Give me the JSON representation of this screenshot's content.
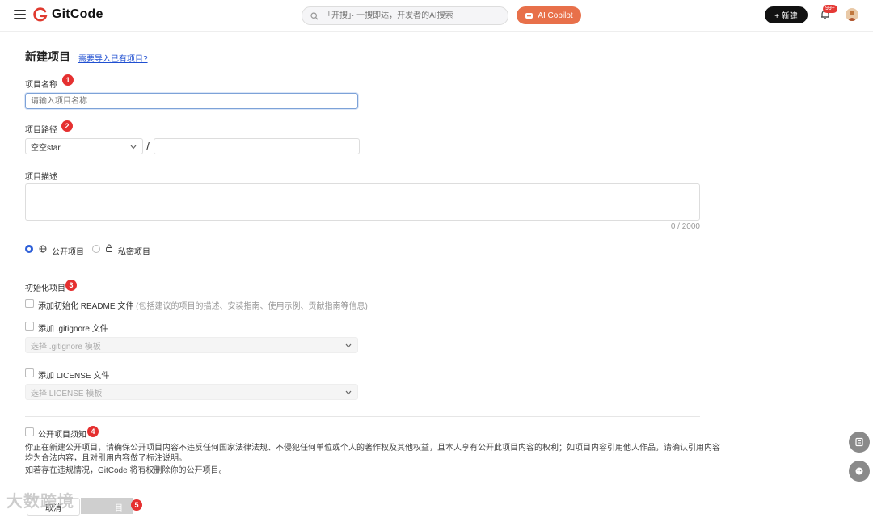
{
  "header": {
    "logo_text": "GitCode",
    "search_placeholder": "「开搜」· 一搜即达，开发者的AI搜索",
    "copilot_label": "AI Copilot",
    "new_label": "+ 新建",
    "notification_count": "99+"
  },
  "form": {
    "title": "新建项目",
    "import_link": "需要导入已有项目?",
    "name_label": "项目名称",
    "name_placeholder": "请输入项目名称",
    "path_label": "项目路径",
    "path_owner": "空空star",
    "path_separator": "/",
    "desc_label": "项目描述",
    "desc_counter": "0 / 2000",
    "visibility_public": "公开项目",
    "visibility_private": "私密项目",
    "init_label": "初始化项目",
    "readme_label": "添加初始化 README 文件",
    "readme_hint": "(包括建议的项目的描述、安装指南、使用示例、贡献指南等信息)",
    "gitignore_label": "添加 .gitignore 文件",
    "gitignore_placeholder": "选择 .gitignore 模板",
    "license_label": "添加 LICENSE 文件",
    "license_placeholder": "选择 LICENSE 模板",
    "notice_label": "公开项目须知",
    "notice_line1": "你正在新建公开项目，请确保公开项目内容不违反任何国家法律法规、不侵犯任何单位或个人的著作权及其他权益，且本人享有公开此项目内容的权利；如项目内容引用他人作品，请确认引用内容",
    "notice_line2": "均为合法内容，且对引用内容做了标注说明。",
    "notice_line3": "如若存在违规情况，GitCode 将有权删除你的公开项目。",
    "cancel_label": "取消",
    "create_fragment": "目"
  },
  "markers": [
    "1",
    "2",
    "3",
    "4",
    "5"
  ],
  "watermark": "大数跨境",
  "colors": {
    "accent": "#2d5fd8",
    "marker": "#e53030",
    "copilot": "#e8704a"
  }
}
